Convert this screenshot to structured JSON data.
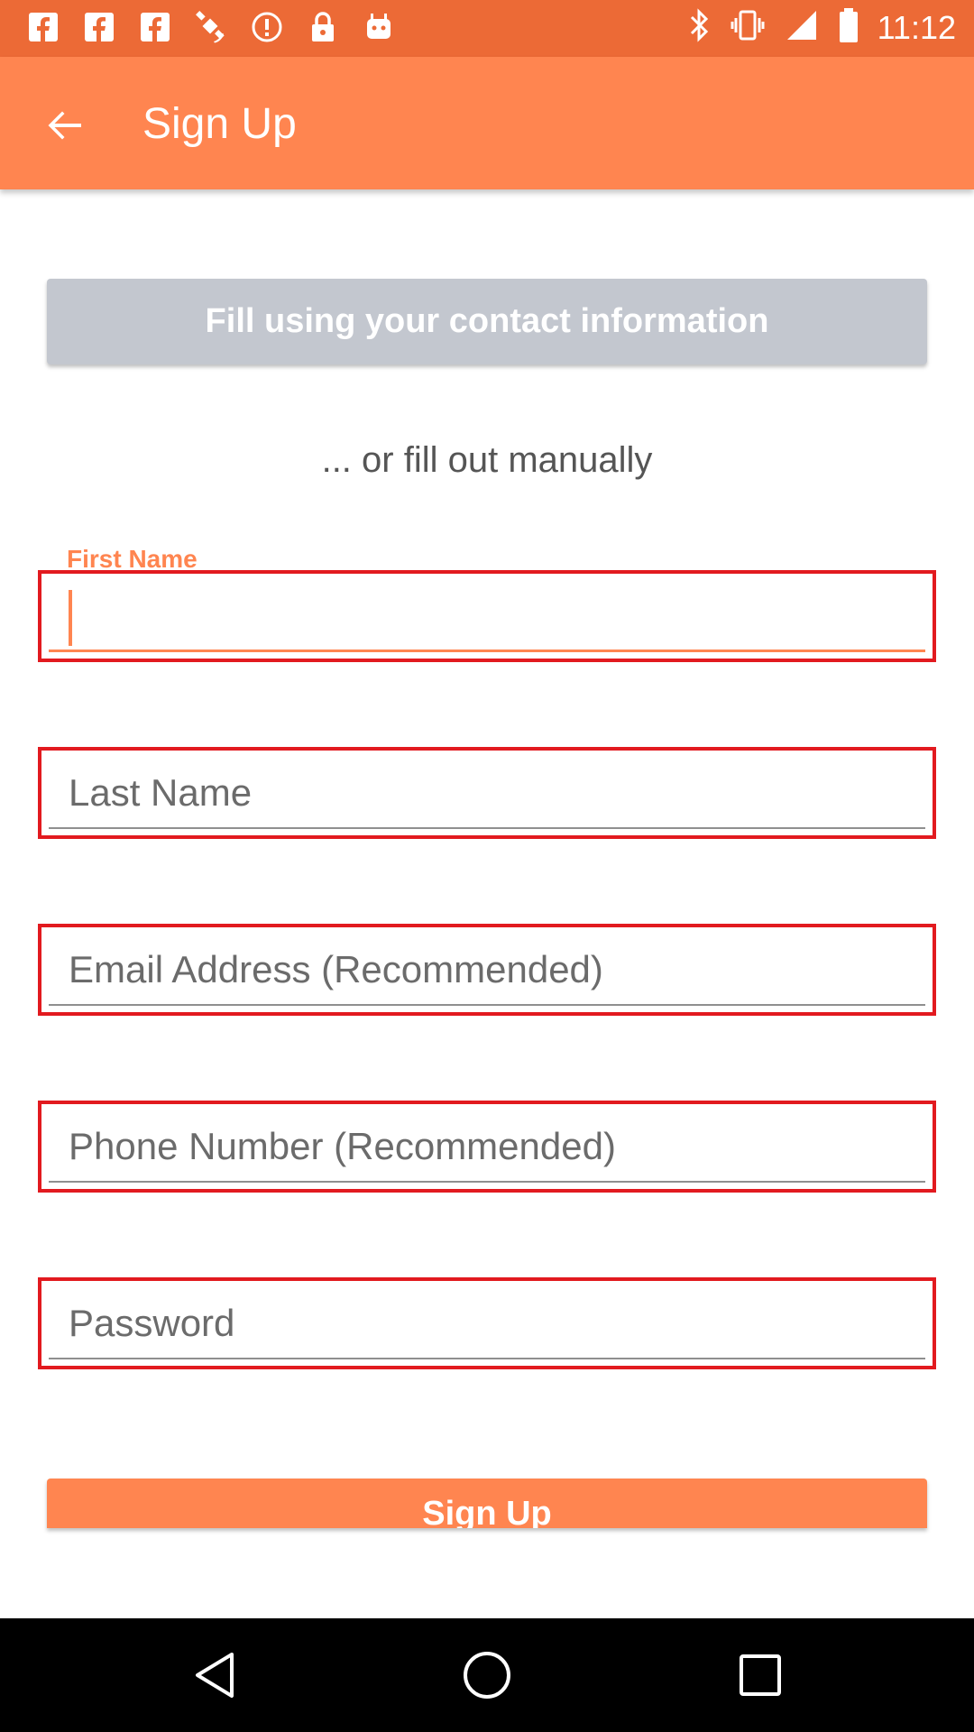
{
  "status_bar": {
    "time": "11:12",
    "icons": [
      "facebook-icon",
      "facebook-icon",
      "facebook-icon",
      "satellite-icon",
      "alert-icon",
      "lock-icon",
      "android-icon",
      "bluetooth-icon",
      "vibrate-icon",
      "signal-icon",
      "battery-icon"
    ]
  },
  "app_bar": {
    "title": "Sign Up",
    "back_icon": "arrow-back-icon"
  },
  "contact_button": {
    "label": "Fill using your contact information"
  },
  "manual_text": "... or fill out manually",
  "form": {
    "first_name": {
      "label": "First Name",
      "value": ""
    },
    "last_name": {
      "placeholder": "Last Name",
      "value": ""
    },
    "email": {
      "placeholder": "Email Address (Recommended)",
      "value": ""
    },
    "phone": {
      "placeholder": "Phone Number (Recommended)",
      "value": ""
    },
    "password": {
      "placeholder": "Password",
      "value": ""
    }
  },
  "signup_button": {
    "label": "Sign Up"
  },
  "nav_bar": {
    "icons": [
      "back-triangle-icon",
      "home-circle-icon",
      "recents-square-icon"
    ]
  },
  "colors": {
    "status_bar": "#ec6a36",
    "app_bar": "#ff8550",
    "contact_button": "#c3c7cf",
    "highlight_border": "#e21a1f",
    "accent": "#ff8550"
  }
}
